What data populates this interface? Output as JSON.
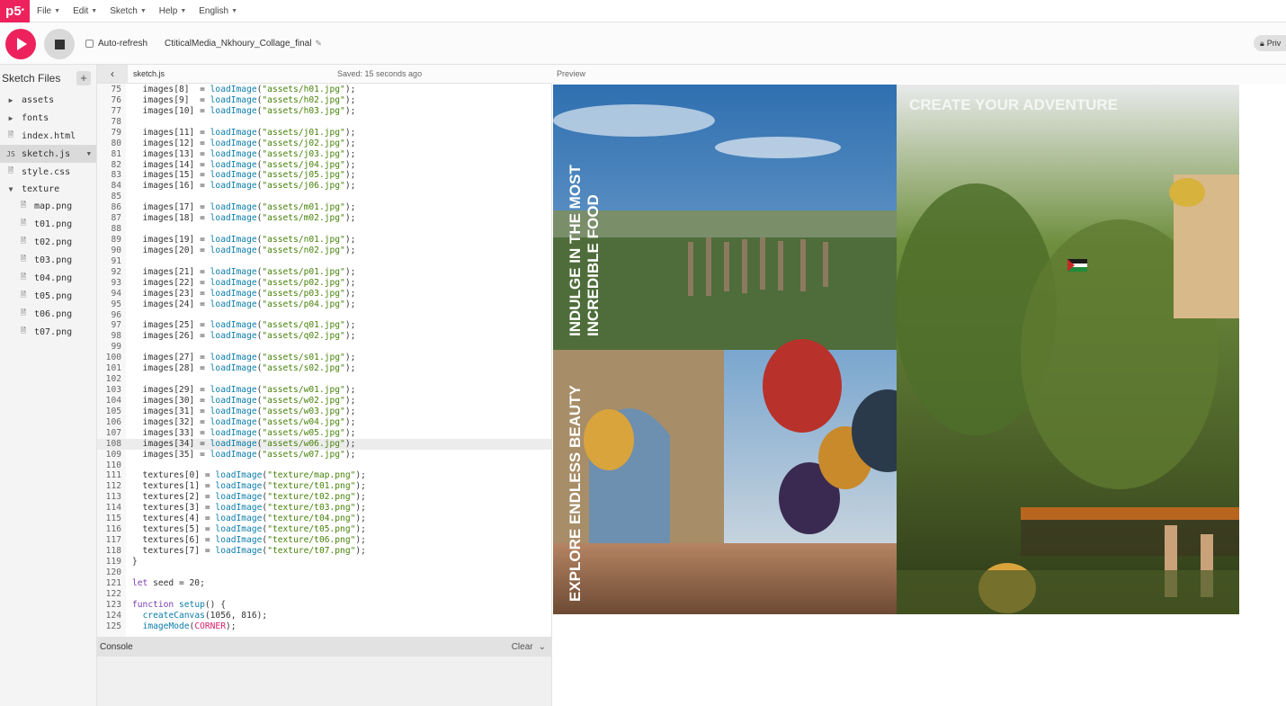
{
  "app": {
    "logo": "p5",
    "logo_sup": "*"
  },
  "menu": [
    {
      "label": "File"
    },
    {
      "label": "Edit"
    },
    {
      "label": "Sketch"
    },
    {
      "label": "Help"
    },
    {
      "label": "English"
    }
  ],
  "toolbar": {
    "autorefresh_label": "Auto-refresh",
    "autorefresh_checked": false,
    "project_name": "CtiticalMedia_Nkhoury_Collage_final",
    "privacy_label": "Priv"
  },
  "sidebar": {
    "title": "Sketch Files",
    "add_icon": "plus-icon",
    "files": [
      {
        "name": "assets",
        "type": "folder"
      },
      {
        "name": "fonts",
        "type": "folder"
      },
      {
        "name": "index.html",
        "type": "file"
      },
      {
        "name": "sketch.js",
        "type": "js",
        "selected": true
      },
      {
        "name": "style.css",
        "type": "file"
      },
      {
        "name": "texture",
        "type": "folder-open"
      },
      {
        "name": "map.png",
        "type": "child"
      },
      {
        "name": "t01.png",
        "type": "child"
      },
      {
        "name": "t02.png",
        "type": "child"
      },
      {
        "name": "t03.png",
        "type": "child"
      },
      {
        "name": "t04.png",
        "type": "child"
      },
      {
        "name": "t05.png",
        "type": "child"
      },
      {
        "name": "t06.png",
        "type": "child"
      },
      {
        "name": "t07.png",
        "type": "child"
      }
    ]
  },
  "editor": {
    "tab": "sketch.js",
    "saved": "Saved: 15 seconds ago",
    "first_line": 75,
    "highlight_line": 108,
    "lines": [
      "  images[8]  = loadImage(\"assets/h01.jpg\");",
      "  images[9]  = loadImage(\"assets/h02.jpg\");",
      "  images[10] = loadImage(\"assets/h03.jpg\");",
      "",
      "  images[11] = loadImage(\"assets/j01.jpg\");",
      "  images[12] = loadImage(\"assets/j02.jpg\");",
      "  images[13] = loadImage(\"assets/j03.jpg\");",
      "  images[14] = loadImage(\"assets/j04.jpg\");",
      "  images[15] = loadImage(\"assets/j05.jpg\");",
      "  images[16] = loadImage(\"assets/j06.jpg\");",
      "",
      "  images[17] = loadImage(\"assets/m01.jpg\");",
      "  images[18] = loadImage(\"assets/m02.jpg\");",
      "",
      "  images[19] = loadImage(\"assets/n01.jpg\");",
      "  images[20] = loadImage(\"assets/n02.jpg\");",
      "",
      "  images[21] = loadImage(\"assets/p01.jpg\");",
      "  images[22] = loadImage(\"assets/p02.jpg\");",
      "  images[23] = loadImage(\"assets/p03.jpg\");",
      "  images[24] = loadImage(\"assets/p04.jpg\");",
      "",
      "  images[25] = loadImage(\"assets/q01.jpg\");",
      "  images[26] = loadImage(\"assets/q02.jpg\");",
      "",
      "  images[27] = loadImage(\"assets/s01.jpg\");",
      "  images[28] = loadImage(\"assets/s02.jpg\");",
      "",
      "  images[29] = loadImage(\"assets/w01.jpg\");",
      "  images[30] = loadImage(\"assets/w02.jpg\");",
      "  images[31] = loadImage(\"assets/w03.jpg\");",
      "  images[32] = loadImage(\"assets/w04.jpg\");",
      "  images[33] = loadImage(\"assets/w05.jpg\");",
      "  images[34] = loadImage(\"assets/w06.jpg\");",
      "  images[35] = loadImage(\"assets/w07.jpg\");",
      "",
      "  textures[0] = loadImage(\"texture/map.png\");",
      "  textures[1] = loadImage(\"texture/t01.png\");",
      "  textures[2] = loadImage(\"texture/t02.png\");",
      "  textures[3] = loadImage(\"texture/t03.png\");",
      "  textures[4] = loadImage(\"texture/t04.png\");",
      "  textures[5] = loadImage(\"texture/t05.png\");",
      "  textures[6] = loadImage(\"texture/t06.png\");",
      "  textures[7] = loadImage(\"texture/t07.png\");",
      "}",
      "",
      "let seed = 20;",
      "",
      "function setup() {",
      "  createCanvas(1056, 816);",
      "  imageMode(CORNER);"
    ]
  },
  "preview": {
    "label": "Preview",
    "headline": "CREATE YOUR ADVENTURE",
    "vertical_text_1": "INDULGE IN THE MOST",
    "vertical_text_2": "INCREDIBLE FOOD",
    "vertical_text_3": "EXPLORE ENDLESS BEAUTY"
  },
  "console": {
    "title": "Console",
    "clear_label": "Clear"
  }
}
